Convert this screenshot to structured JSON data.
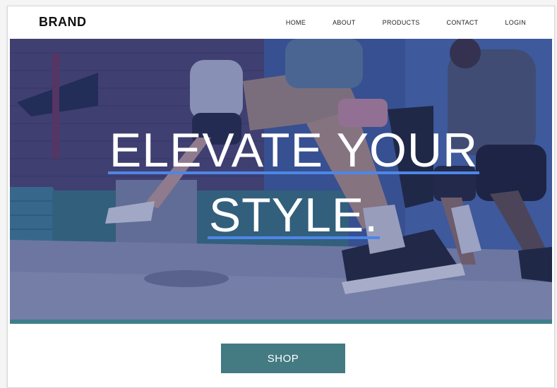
{
  "nav": {
    "brand": "BRAND",
    "links": [
      "HOME",
      "ABOUT",
      "PRODUCTS",
      "CONTACT",
      "LOGIN"
    ]
  },
  "hero": {
    "headline_line1": "ELEVATE YOUR",
    "headline_line2": "STYLE.",
    "image_subject": "runners-street-photo",
    "overlay_color": "#2e3f78"
  },
  "cta": {
    "shop_label": "SHOP",
    "button_color": "#447a82"
  },
  "colors": {
    "accent_underline": "#4d86e8",
    "strip": "#3f7f8a"
  }
}
